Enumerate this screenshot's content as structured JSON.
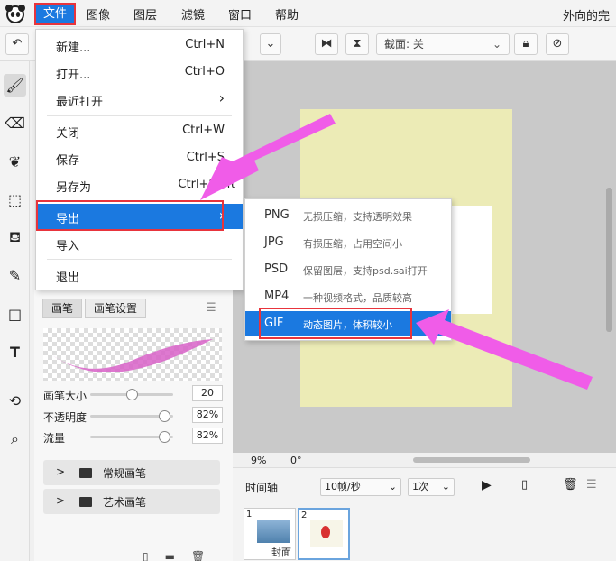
{
  "menubar": {
    "items": [
      "文件",
      "图像",
      "图层",
      "滤镜",
      "窗口",
      "帮助"
    ],
    "title": "外向的完"
  },
  "toolbar": {
    "crop_label": "截面: 关",
    "undo_icon": "undo-arrow-icon",
    "flip_h_icon": "flip-horizontal-icon",
    "flip_v_icon": "flip-vertical-icon",
    "lock_icon": "lock-icon",
    "clear_icon": "no-entry-icon"
  },
  "toolbox": [
    "brush-icon",
    "eraser-icon",
    "smudge-icon",
    "select-icon",
    "fill-icon",
    "eyedropper-icon",
    "rectangle-icon",
    "text-icon",
    "rotate-icon",
    "zoom-icon"
  ],
  "file_menu": {
    "items": [
      {
        "label": "新建...",
        "shortcut": "Ctrl+N"
      },
      {
        "label": "打开...",
        "shortcut": "Ctrl+O"
      },
      {
        "label": "最近打开",
        "shortcut": ""
      },
      {
        "label": "关闭",
        "shortcut": "Ctrl+W"
      },
      {
        "label": "保存",
        "shortcut": "Ctrl+S"
      },
      {
        "label": "另存为",
        "shortcut": "Ctrl+Shift"
      },
      {
        "label": "导出",
        "shortcut": ""
      },
      {
        "label": "导入",
        "shortcut": ""
      },
      {
        "label": "退出",
        "shortcut": ""
      }
    ]
  },
  "export_menu": {
    "items": [
      {
        "format": "PNG",
        "desc": "无损压缩，支持透明效果"
      },
      {
        "format": "JPG",
        "desc": "有损压缩，占用空间小"
      },
      {
        "format": "PSD",
        "desc": "保留图层，支持psd.sai打开"
      },
      {
        "format": "MP4",
        "desc": "一种视频格式，品质较高"
      },
      {
        "format": "GIF",
        "desc": "动态图片，体积较小"
      }
    ]
  },
  "brush_panel": {
    "tabs": [
      "画笔",
      "画笔设置"
    ],
    "sliders": [
      {
        "label": "画笔大小",
        "value": "20",
        "level": 0.5
      },
      {
        "label": "不透明度",
        "value": "82%",
        "level": 0.9
      },
      {
        "label": "流量",
        "value": "82%",
        "level": 0.9
      }
    ],
    "groups": [
      "常规画笔",
      "艺术画笔"
    ]
  },
  "status": {
    "zoom": "9%",
    "rotation": "0°"
  },
  "timeline": {
    "label": "时间轴",
    "fps": "10帧/秒",
    "loop": "1次",
    "frames": [
      {
        "num": "1",
        "caption": "封面"
      },
      {
        "num": "2",
        "caption": ""
      }
    ]
  },
  "colors": {
    "accent": "#1b79e0",
    "highlight": "#e8343c",
    "arrow": "#f05ce8",
    "canvas": "#ecebb6"
  }
}
